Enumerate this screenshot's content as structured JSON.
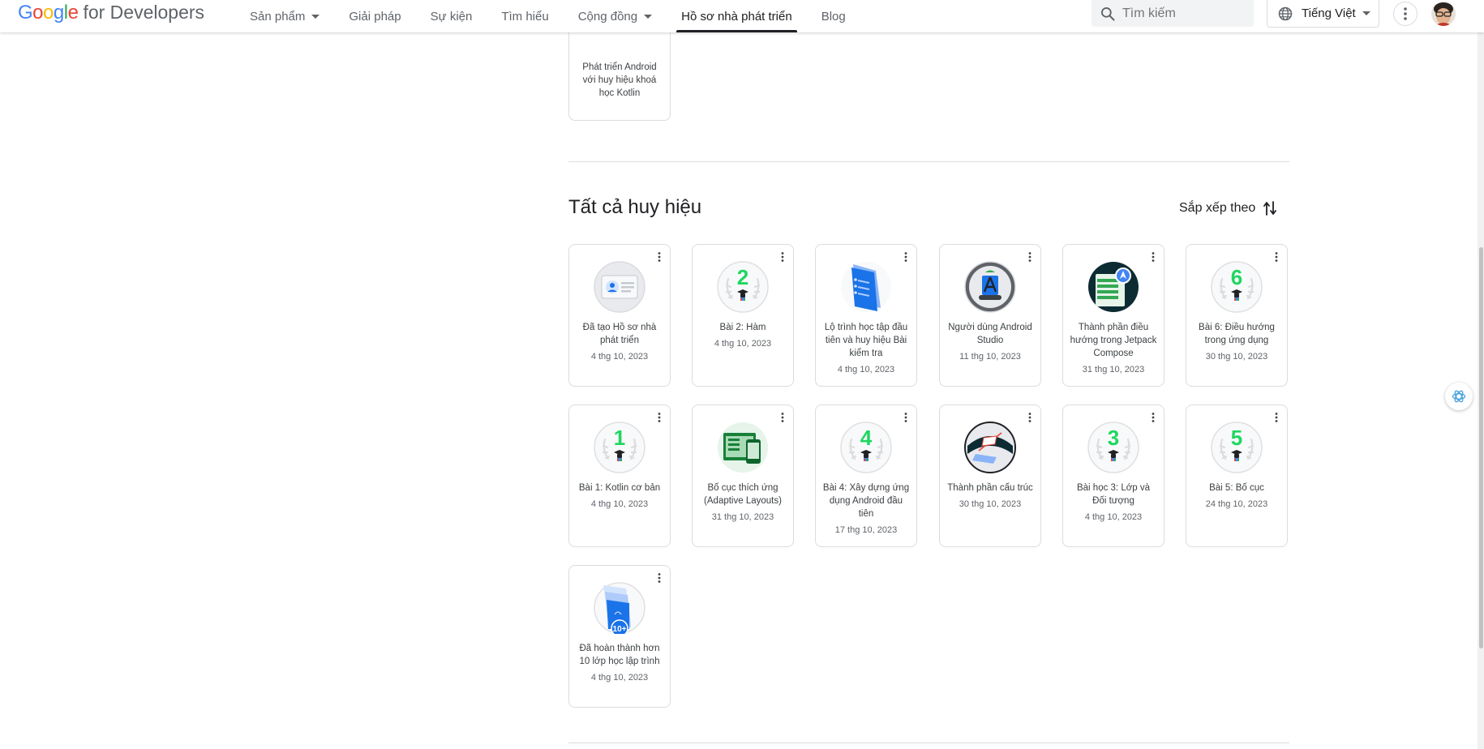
{
  "brand": {
    "logo_letters": [
      "G",
      "o",
      "o",
      "g",
      "l",
      "e"
    ],
    "suffix": "for Developers",
    "colors": [
      "#4285f4",
      "#ea4335",
      "#fbbc04",
      "#4285f4",
      "#34a853",
      "#ea4335"
    ]
  },
  "nav": {
    "items": [
      {
        "label": "Sản phẩm",
        "dropdown": true
      },
      {
        "label": "Giải pháp",
        "dropdown": false
      },
      {
        "label": "Sự kiện",
        "dropdown": false
      },
      {
        "label": "Tìm hiểu",
        "dropdown": false
      },
      {
        "label": "Cộng đồng",
        "dropdown": true
      },
      {
        "label": "Hồ sơ nhà phát triển",
        "dropdown": false,
        "active": true
      },
      {
        "label": "Blog",
        "dropdown": false
      }
    ]
  },
  "search": {
    "placeholder": "Tìm kiếm",
    "icon": "search-icon"
  },
  "language": {
    "label": "Tiếng Việt",
    "icon": "globe-icon"
  },
  "top_card": {
    "title": "Phát triển Android với huy hiệu khoá học Kotlin"
  },
  "section": {
    "title": "Tất cả huy hiệu",
    "sort_label": "Sắp xếp theo"
  },
  "badges": [
    {
      "title": "Đã tạo Hồ sơ nhà phát triển",
      "date": "4 thg 10, 2023",
      "icon": "profile-badge-icon"
    },
    {
      "title": "Bài 2: Hàm",
      "date": "4 thg 10, 2023",
      "icon": "number-badge-icon",
      "number": "2"
    },
    {
      "title": "Lộ trình học tập đầu tiên và huy hiệu Bài kiểm tra",
      "date": "4 thg 10, 2023",
      "icon": "pathway-badge-icon"
    },
    {
      "title": "Người dùng Android Studio",
      "date": "11 thg 10, 2023",
      "icon": "android-studio-badge-icon"
    },
    {
      "title": "Thành phần điều hướng trong Jetpack Compose",
      "date": "31 thg 10, 2023",
      "icon": "navigation-badge-icon"
    },
    {
      "title": "Bài 6: Điều hướng trong ứng dụng",
      "date": "30 thg 10, 2023",
      "icon": "number-badge-icon",
      "number": "6"
    },
    {
      "title": "Bài 1: Kotlin cơ bản",
      "date": "4 thg 10, 2023",
      "icon": "number-badge-icon",
      "number": "1"
    },
    {
      "title": "Bố cục thích ứng (Adaptive Layouts)",
      "date": "31 thg 10, 2023",
      "icon": "adaptive-layout-badge-icon"
    },
    {
      "title": "Bài 4: Xây dựng ứng dụng Android đầu tiên",
      "date": "17 thg 10, 2023",
      "icon": "number-badge-icon",
      "number": "4"
    },
    {
      "title": "Thành phần cấu trúc",
      "date": "30 thg 10, 2023",
      "icon": "architecture-badge-icon"
    },
    {
      "title": "Bài học 3: Lớp và Đối tượng",
      "date": "4 thg 10, 2023",
      "icon": "number-badge-icon",
      "number": "3"
    },
    {
      "title": "Bài 5: Bố cục",
      "date": "24 thg 10, 2023",
      "icon": "number-badge-icon",
      "number": "5"
    },
    {
      "title": "Đã hoàn thành hơn 10 lớp học lập trình",
      "date": "4 thg 10, 2023",
      "icon": "codelabs-badge-icon",
      "number": "10+"
    }
  ],
  "colors": {
    "number_green": "#1ed760",
    "accent_blue": "#1a73e8",
    "border": "#dadce0"
  }
}
